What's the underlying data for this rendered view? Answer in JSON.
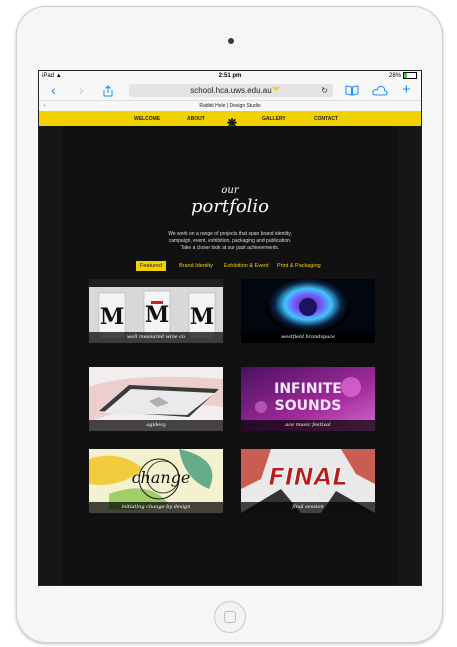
{
  "status_bar": {
    "device": "iPad",
    "wifi": "▲",
    "time": "2:51 pm",
    "battery": "28%",
    "battery_level": 0.28
  },
  "browser": {
    "url": "school.hca.uws.edu.au",
    "tab_title": "Rabbit Hole | Design Studio",
    "icons": {
      "back": "back-arrow-icon",
      "forward": "forward-arrow-icon",
      "share": "share-icon",
      "bookmarks": "book-icon",
      "cloud": "cloud-tabs-icon",
      "new_tab": "plus-icon",
      "reload": "reload-icon"
    }
  },
  "site_nav": {
    "items": [
      "WELCOME",
      "ABOUT",
      "GALLERY",
      "CONTACT"
    ],
    "active": "GALLERY",
    "logo_icon": "rabbit-logo-icon"
  },
  "hero": {
    "our": "our",
    "portfolio": "portfolio",
    "intro_line1": "We work on a range of projects that span brand identity,",
    "intro_line2": "campaign, event, exhibition, packaging and publication.",
    "intro_line3": "Take a closer look at our past achievements."
  },
  "filters": {
    "items": [
      "Featured",
      "Brand Identity",
      "Exhibition & Event",
      "Print & Packaging"
    ],
    "active": "Featured"
  },
  "portfolio_items": [
    {
      "caption": "well measured wine co"
    },
    {
      "caption": "westfield brandspace"
    },
    {
      "caption": "agidesy"
    },
    {
      "caption": "ace music festival"
    },
    {
      "caption": "initiating change by design"
    },
    {
      "caption": "final session"
    }
  ],
  "colors": {
    "accent": "#f1d100",
    "page_bg": "#111111",
    "link_blue": "#1a8cff"
  }
}
